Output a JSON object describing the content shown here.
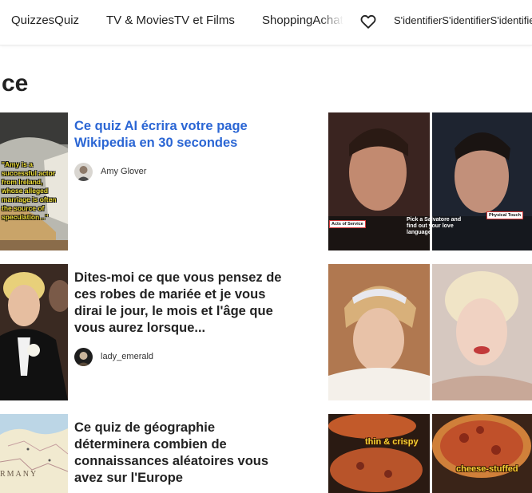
{
  "nav": {
    "quizzes": "QuizzesQuiz",
    "tv_movies": "TV & MoviesTV et Films",
    "shopping": "ShoppingAchats",
    "signin": "S'identifierS'identifierS'identifier"
  },
  "section_title": "ce",
  "cards": [
    {
      "title": "Ce quiz AI écrira votre page Wikipedia en 30 secondes",
      "author": "Amy Glover",
      "thumb_caption": "\"Amy is a successful actor from Ireland, whose alleged marriage is often the source of speculation...\""
    },
    {
      "title": "Dites-moi ce que vous pensez de ces robes de mariée et je vous dirai le jour, le mois et l'âge que vous aurez lorsque...",
      "author": "lady_emerald"
    },
    {
      "title": "Ce quiz de géographie déterminera combien de connaissances aléatoires vous avez sur l'Europe",
      "thumb_caption": "RMANY"
    }
  ],
  "promos": [
    {
      "left_tag": "Acts of Service",
      "center_text": "Pick a Salvatore and find out your love language",
      "right_tag": "Physical Touch"
    },
    {},
    {
      "left_label": "thin & crispy",
      "right_label": "cheese-stuffed"
    }
  ],
  "colors": {
    "link": "#2b66d4",
    "text": "#222222",
    "tag_border": "#d83a3a",
    "food_label": "#f5d133"
  },
  "icons": {
    "heart": "heart-icon"
  }
}
